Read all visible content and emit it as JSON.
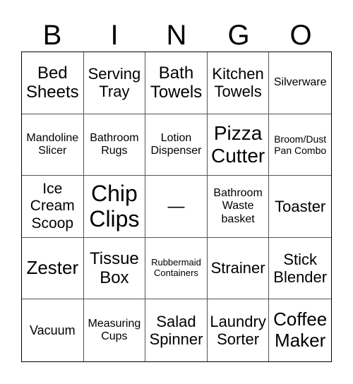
{
  "header": [
    "B",
    "I",
    "N",
    "G",
    "O"
  ],
  "cells": [
    "Bed\nSheets",
    "Serving\nTray",
    "Bath\nTowels",
    "Kitchen\nTowels",
    "Silverware",
    "Mandoline\nSlicer",
    "Bathroom\nRugs",
    "Lotion\nDispenser",
    "Pizza\nCutter",
    "Broom/Dust\nPan Combo",
    "Ice\nCream\nScoop",
    "Chip\nClips",
    "—",
    "Bathroom\nWaste\nbasket",
    "Toaster",
    "Zester",
    "Tissue\nBox",
    "Rubbermaid\nContainers",
    "Strainer",
    "Stick\nBlender",
    "Vacuum",
    "Measuring\nCups",
    "Salad\nSpinner",
    "Laundry\nSorter",
    "Coffee\nMaker"
  ]
}
